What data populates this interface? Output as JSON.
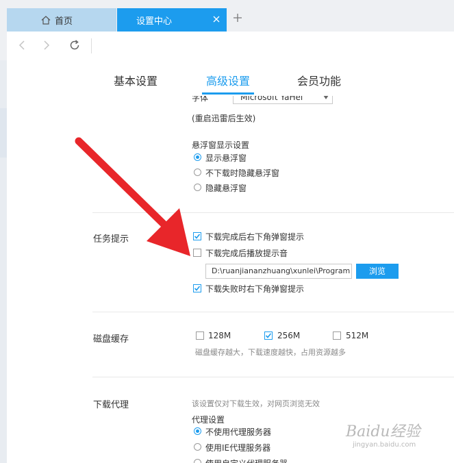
{
  "tabs": {
    "home_label": "首页",
    "active_label": "设置中心"
  },
  "settings_tabs": [
    "基本设置",
    "高级设置",
    "会员功能"
  ],
  "font": {
    "label": "字体",
    "value": "Microsoft YaHei",
    "restart_note": "(重启迅雷后生效)"
  },
  "float_window": {
    "title": "悬浮窗显示设置",
    "options": [
      "显示悬浮窗",
      "不下载时隐藏悬浮窗",
      "隐藏悬浮窗"
    ],
    "selected": 0
  },
  "task_notify": {
    "title": "任务提示",
    "popup_done": "下载完成后右下角弹窗提示",
    "sound_done": "下载完成后播放提示音",
    "sound_path": "D:\\ruanjiananzhuang\\xunlei\\Program",
    "browse": "浏览",
    "popup_fail": "下载失败时右下角弹窗提示"
  },
  "disk_cache": {
    "title": "磁盘缓存",
    "options": [
      "128M",
      "256M",
      "512M"
    ],
    "selected": 1,
    "hint": "磁盘缓存越大，下载速度越快，占用资源越多"
  },
  "proxy": {
    "title": "下载代理",
    "note": "该设置仅对下载生效，对网页浏览无效",
    "subtitle": "代理设置",
    "options": [
      "不使用代理服务器",
      "使用IE代理服务器",
      "使用自定义代理服务器"
    ]
  },
  "watermark": {
    "main": "Baidu经验",
    "sub": "jingyan.baidu.com"
  },
  "colors": {
    "accent": "#1c9cee",
    "arrow": "#e8262a"
  }
}
